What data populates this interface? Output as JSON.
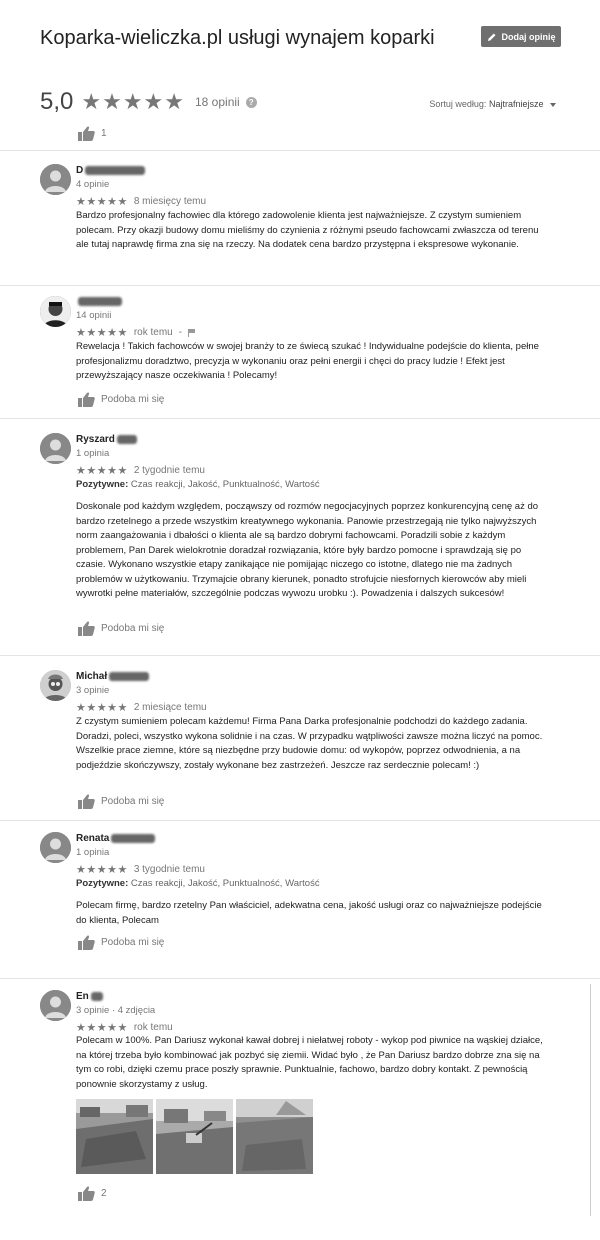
{
  "header": {
    "title": "Koparka-wieliczka.pl usługi wynajem koparki",
    "add_review": "Dodaj opinię"
  },
  "summary": {
    "rating": "5,0",
    "stars": "★★★★★",
    "count": "18 opinii",
    "sort_label": "Sortuj według:",
    "sort_value": "Najtrafniejsze"
  },
  "top_likes": "1",
  "reviews": [
    {
      "name": "D",
      "meta": "4 opinie",
      "stars": "★★★★★",
      "time": "8 miesięcy temu",
      "text": "Bardzo profesjonalny fachowiec dla którego zadowolenie klienta jest najważniejsze. Z czystym sumieniem polecam. Przy okazji budowy domu mieliśmy do czynienia z różnymi pseudo fachowcami zwłaszcza od terenu ale tutaj naprawdę firma zna się na rzeczy. Na dodatek cena bardzo przystępna i ekspresowe wykonanie."
    },
    {
      "name": "",
      "meta": "14 opinii",
      "stars": "★★★★★",
      "time": "rok temu",
      "text": "Rewelacja ! Takich fachowców w swojej branży to ze świecą szukać ! Indywidualne podejście do klienta, pełne profesjonalizmu doradztwo, precyzja w wykonaniu oraz pełni energii i chęci do pracy ludzie ! Efekt jest przewyższający nasze oczekiwania ! Polecamy!",
      "like": "Podoba mi się"
    },
    {
      "name": "Ryszard",
      "meta": "1 opinia",
      "stars": "★★★★★",
      "time": "2 tygodnie temu",
      "positive_label": "Pozytywne:",
      "positive": "Czas reakcji, Jakość, Punktualność, Wartość",
      "text": "Doskonale pod każdym względem, począwszy od rozmów negocjacyjnych poprzez konkurencyjną cenę aż do bardzo rzetelnego a przede wszystkim kreatywnego wykonania. Panowie przestrzegają nie tylko najwyższych norm zaangażowania i dbałości o klienta ale są bardzo  dobrymi fachowcami. Poradzili sobie z każdym problemem, Pan Darek wielokrotnie doradzał rozwiązania, które były bardzo pomocne i sprawdzają się po czasie. Wykonano wszystkie etapy zanikające nie pomijając niczego co istotne, dlatego nie ma żadnych problemów w użytkowaniu. Trzymajcie obrany kierunek, ponadto strofujcie niesfornych kierowców aby mieli wywrotki pełne materiałów, szczególnie podczas wywozu urobku :). Powadzenia i dalszych sukcesów!",
      "like": "Podoba mi się"
    },
    {
      "name": "Michał",
      "meta": "3 opinie",
      "stars": "★★★★★",
      "time": "2 miesiące temu",
      "text": "Z czystym sumieniem polecam każdemu! Firma Pana Darka profesjonalnie podchodzi do każdego zadania. Doradzi, poleci, wszystko wykona solidnie i na czas. W przypadku wątpliwości zawsze można liczyć na pomoc. Wszelkie prace ziemne, które są niezbędne przy budowie domu: od wykopów, poprzez odwodnienia, a na podjeździe skończywszy, zostały wykonane bez zastrzeżeń. Jeszcze raz serdecznie polecam! :)",
      "like": "Podoba mi się"
    },
    {
      "name": "Renata",
      "meta": "1 opinia",
      "stars": "★★★★★",
      "time": "3 tygodnie temu",
      "positive_label": "Pozytywne:",
      "positive": "Czas reakcji, Jakość, Punktualność, Wartość",
      "text": "Polecam firmę, bardzo rzetelny Pan właściciel, adekwatna cena, jakość usługi oraz co najważniejsze podejście do klienta, Polecam",
      "like": "Podoba mi się"
    },
    {
      "name": "En",
      "meta": "3 opinie · 4 zdjęcia",
      "stars": "★★★★★",
      "time": "rok temu",
      "text": "Polecam w 100%. Pan Dariusz wykonał kawał dobrej i niełatwej roboty - wykop pod piwnice na wąskiej działce, na której trzeba było kombinować jak pozbyć się ziemii. Widać było , że Pan Dariusz bardzo dobrze zna się na tym co robi, dzięki czemu prace poszły sprawnie. Punktualnie, fachowo, bardzo dobry kontakt. Z pewnością ponownie skorzystamy z usług.",
      "likes": "2"
    }
  ],
  "colors": {
    "accent": "#6f6f6f",
    "star": "#777777"
  }
}
